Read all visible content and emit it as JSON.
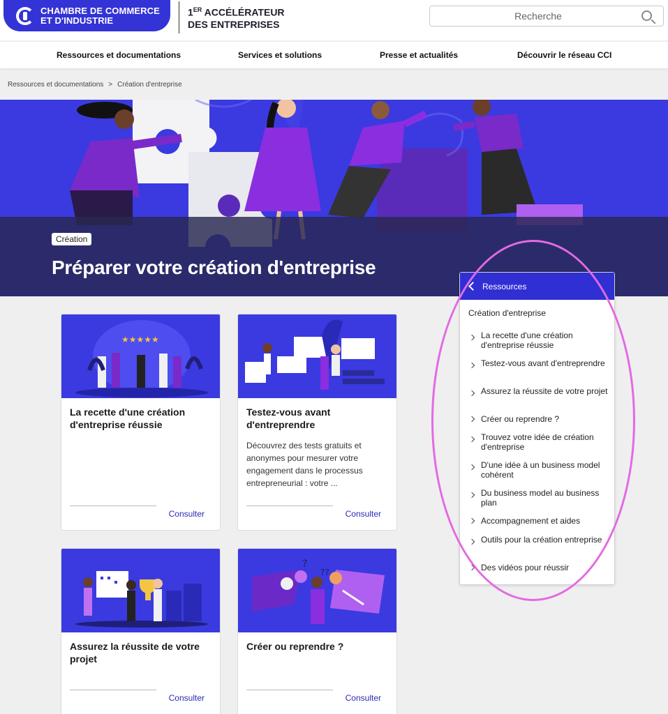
{
  "header": {
    "logo_line1": "CHAMBRE DE COMMERCE",
    "logo_line2": "ET D'INDUSTRIE",
    "tagline_sup": "ER",
    "tagline_line1_prefix": "1",
    "tagline_line1_rest": " ACCÉLÉRATEUR",
    "tagline_line2": "DES ENTREPRISES",
    "search_placeholder": "Recherche"
  },
  "nav": {
    "items": [
      "Ressources et documentations",
      "Services et solutions",
      "Presse et actualités",
      "Découvrir le réseau CCI"
    ]
  },
  "breadcrumb": {
    "items": [
      "Ressources et documentations",
      "Création d'entreprise"
    ],
    "separator": ">"
  },
  "hero": {
    "tag": "Création",
    "title": "Préparer votre création d'entreprise"
  },
  "cards": [
    {
      "title": "La recette d'une création d'entreprise réussie",
      "desc": "",
      "link": "Consulter"
    },
    {
      "title": "Testez-vous avant d'entreprendre",
      "desc": "Découvrez des tests gratuits et anonymes pour mesurer votre engagement dans le processus entrepreneurial : votre ...",
      "link": "Consulter"
    },
    {
      "title": "Assurez la réussite de votre projet",
      "desc": "",
      "link": "Consulter"
    },
    {
      "title": "Créer ou reprendre ?",
      "desc": "",
      "link": "Consulter"
    }
  ],
  "sidebar": {
    "header": "Ressources",
    "section": "Création d'entreprise",
    "items": [
      "La recette d'une création d'entreprise réussie",
      "Testez-vous avant d'entreprendre",
      "Assurez la réussite de votre projet",
      "Créer ou reprendre ?",
      "Trouvez votre idée de création d'entreprise",
      "D'une idée à un business model cohérent",
      "Du business model au business plan",
      "Accompagnement et aides",
      "Outils pour la création entreprise",
      "Des vidéos pour réussir"
    ]
  },
  "colors": {
    "brand_blue": "#3333d6",
    "hero_blue": "#3a3ae0",
    "highlight_pink": "#e36ae3",
    "link_blue": "#2a2ab8"
  },
  "icons": [
    "logo-mark-icon",
    "search-icon",
    "chevron-left-icon",
    "chevron-right-icon"
  ]
}
